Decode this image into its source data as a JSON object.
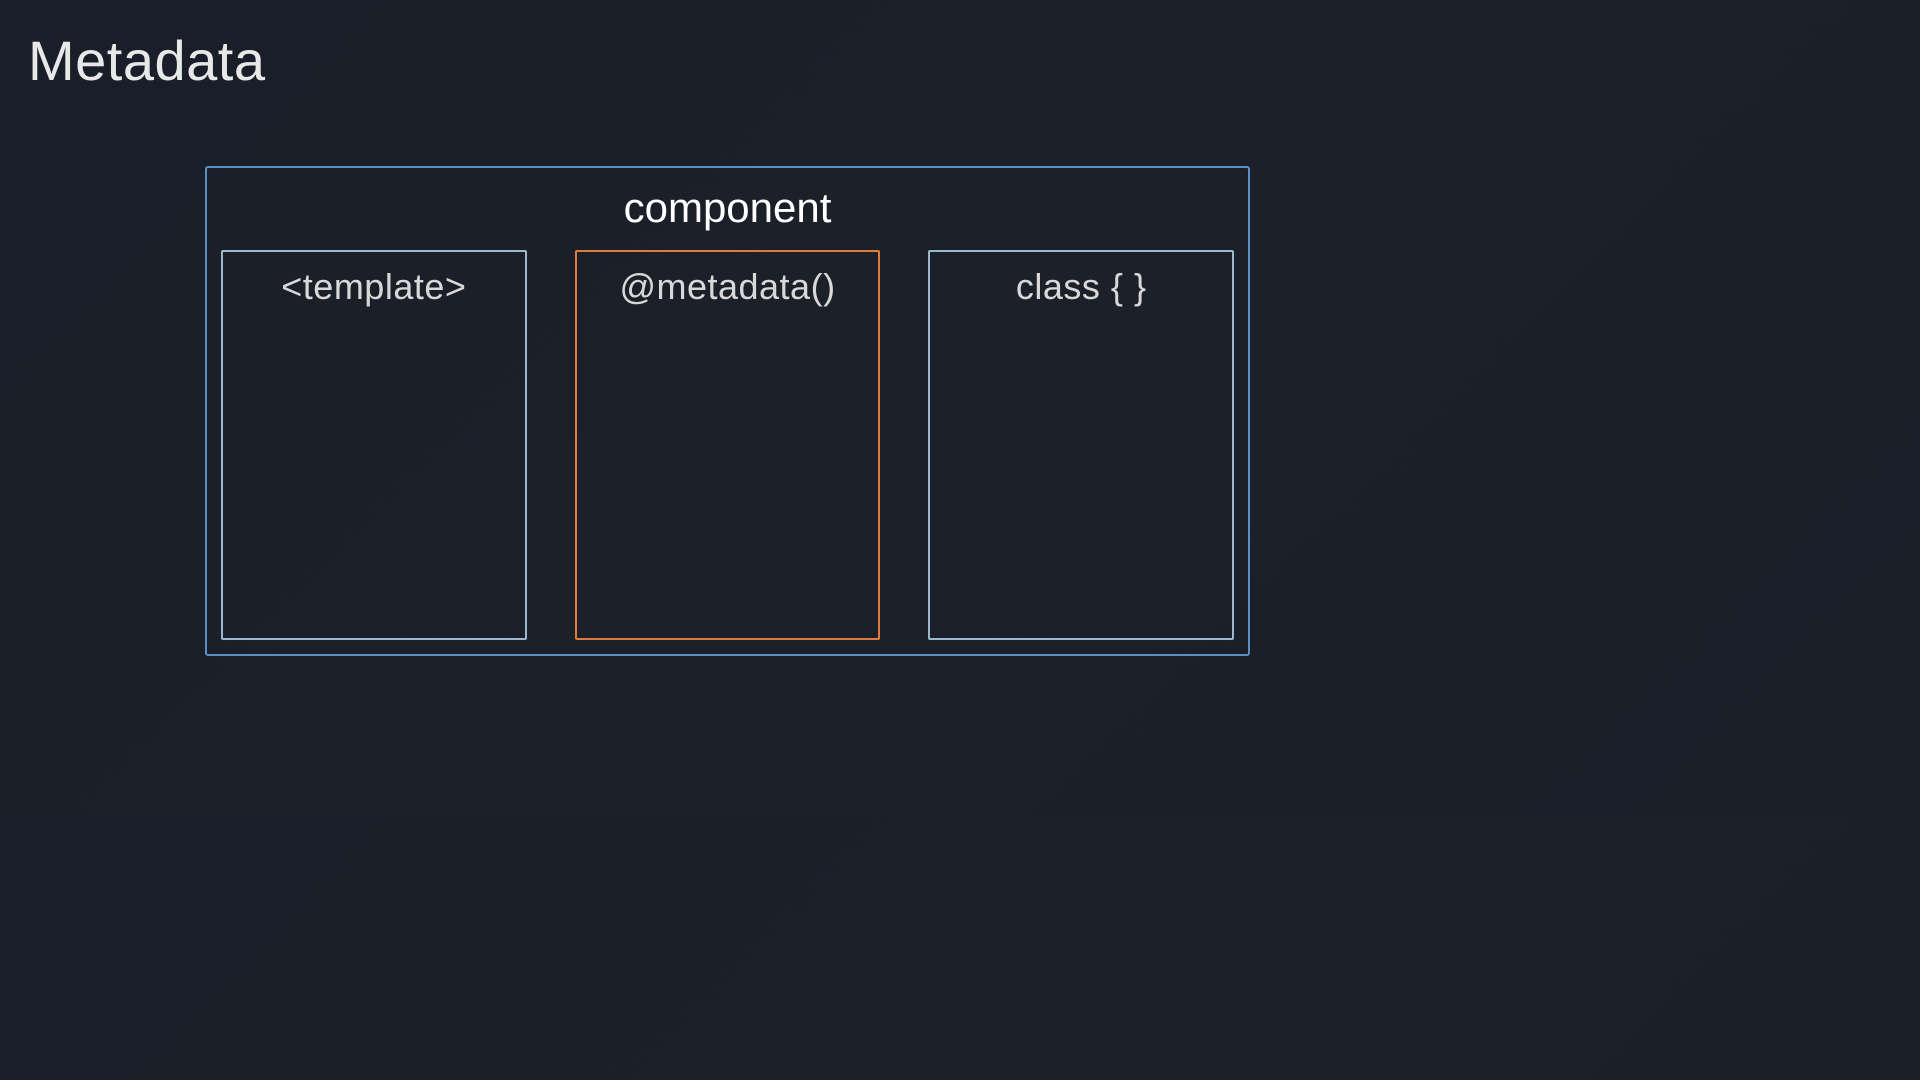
{
  "title": "Metadata",
  "component": {
    "label": "component",
    "boxes": [
      {
        "label": "<template>",
        "highlighted": false
      },
      {
        "label": "@metadata()",
        "highlighted": true
      },
      {
        "label": "class { }",
        "highlighted": false
      }
    ]
  },
  "colors": {
    "outerBorder": "#5a8ec4",
    "innerBorder": "#9db8cc",
    "highlightBorder": "#e07b3a"
  }
}
